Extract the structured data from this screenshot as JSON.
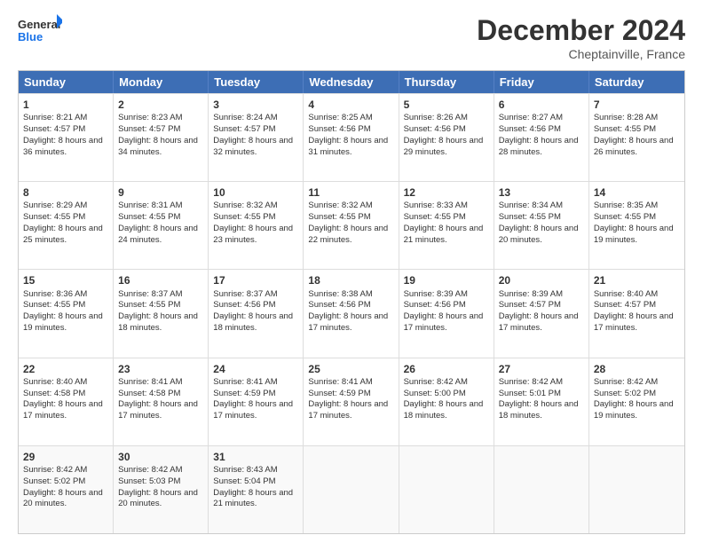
{
  "header": {
    "logo_general": "General",
    "logo_blue": "Blue",
    "month": "December 2024",
    "location": "Cheptainville, France"
  },
  "days": [
    "Sunday",
    "Monday",
    "Tuesday",
    "Wednesday",
    "Thursday",
    "Friday",
    "Saturday"
  ],
  "weeks": [
    [
      {
        "day": "1",
        "sunrise": "8:21 AM",
        "sunset": "4:57 PM",
        "daylight": "8 hours and 36 minutes."
      },
      {
        "day": "2",
        "sunrise": "8:23 AM",
        "sunset": "4:57 PM",
        "daylight": "8 hours and 34 minutes."
      },
      {
        "day": "3",
        "sunrise": "8:24 AM",
        "sunset": "4:57 PM",
        "daylight": "8 hours and 32 minutes."
      },
      {
        "day": "4",
        "sunrise": "8:25 AM",
        "sunset": "4:56 PM",
        "daylight": "8 hours and 31 minutes."
      },
      {
        "day": "5",
        "sunrise": "8:26 AM",
        "sunset": "4:56 PM",
        "daylight": "8 hours and 29 minutes."
      },
      {
        "day": "6",
        "sunrise": "8:27 AM",
        "sunset": "4:56 PM",
        "daylight": "8 hours and 28 minutes."
      },
      {
        "day": "7",
        "sunrise": "8:28 AM",
        "sunset": "4:55 PM",
        "daylight": "8 hours and 26 minutes."
      }
    ],
    [
      {
        "day": "8",
        "sunrise": "8:29 AM",
        "sunset": "4:55 PM",
        "daylight": "8 hours and 25 minutes."
      },
      {
        "day": "9",
        "sunrise": "8:31 AM",
        "sunset": "4:55 PM",
        "daylight": "8 hours and 24 minutes."
      },
      {
        "day": "10",
        "sunrise": "8:32 AM",
        "sunset": "4:55 PM",
        "daylight": "8 hours and 23 minutes."
      },
      {
        "day": "11",
        "sunrise": "8:32 AM",
        "sunset": "4:55 PM",
        "daylight": "8 hours and 22 minutes."
      },
      {
        "day": "12",
        "sunrise": "8:33 AM",
        "sunset": "4:55 PM",
        "daylight": "8 hours and 21 minutes."
      },
      {
        "day": "13",
        "sunrise": "8:34 AM",
        "sunset": "4:55 PM",
        "daylight": "8 hours and 20 minutes."
      },
      {
        "day": "14",
        "sunrise": "8:35 AM",
        "sunset": "4:55 PM",
        "daylight": "8 hours and 19 minutes."
      }
    ],
    [
      {
        "day": "15",
        "sunrise": "8:36 AM",
        "sunset": "4:55 PM",
        "daylight": "8 hours and 19 minutes."
      },
      {
        "day": "16",
        "sunrise": "8:37 AM",
        "sunset": "4:55 PM",
        "daylight": "8 hours and 18 minutes."
      },
      {
        "day": "17",
        "sunrise": "8:37 AM",
        "sunset": "4:56 PM",
        "daylight": "8 hours and 18 minutes."
      },
      {
        "day": "18",
        "sunrise": "8:38 AM",
        "sunset": "4:56 PM",
        "daylight": "8 hours and 17 minutes."
      },
      {
        "day": "19",
        "sunrise": "8:39 AM",
        "sunset": "4:56 PM",
        "daylight": "8 hours and 17 minutes."
      },
      {
        "day": "20",
        "sunrise": "8:39 AM",
        "sunset": "4:57 PM",
        "daylight": "8 hours and 17 minutes."
      },
      {
        "day": "21",
        "sunrise": "8:40 AM",
        "sunset": "4:57 PM",
        "daylight": "8 hours and 17 minutes."
      }
    ],
    [
      {
        "day": "22",
        "sunrise": "8:40 AM",
        "sunset": "4:58 PM",
        "daylight": "8 hours and 17 minutes."
      },
      {
        "day": "23",
        "sunrise": "8:41 AM",
        "sunset": "4:58 PM",
        "daylight": "8 hours and 17 minutes."
      },
      {
        "day": "24",
        "sunrise": "8:41 AM",
        "sunset": "4:59 PM",
        "daylight": "8 hours and 17 minutes."
      },
      {
        "day": "25",
        "sunrise": "8:41 AM",
        "sunset": "4:59 PM",
        "daylight": "8 hours and 17 minutes."
      },
      {
        "day": "26",
        "sunrise": "8:42 AM",
        "sunset": "5:00 PM",
        "daylight": "8 hours and 18 minutes."
      },
      {
        "day": "27",
        "sunrise": "8:42 AM",
        "sunset": "5:01 PM",
        "daylight": "8 hours and 18 minutes."
      },
      {
        "day": "28",
        "sunrise": "8:42 AM",
        "sunset": "5:02 PM",
        "daylight": "8 hours and 19 minutes."
      }
    ],
    [
      {
        "day": "29",
        "sunrise": "8:42 AM",
        "sunset": "5:02 PM",
        "daylight": "8 hours and 20 minutes."
      },
      {
        "day": "30",
        "sunrise": "8:42 AM",
        "sunset": "5:03 PM",
        "daylight": "8 hours and 20 minutes."
      },
      {
        "day": "31",
        "sunrise": "8:43 AM",
        "sunset": "5:04 PM",
        "daylight": "8 hours and 21 minutes."
      },
      null,
      null,
      null,
      null
    ]
  ]
}
